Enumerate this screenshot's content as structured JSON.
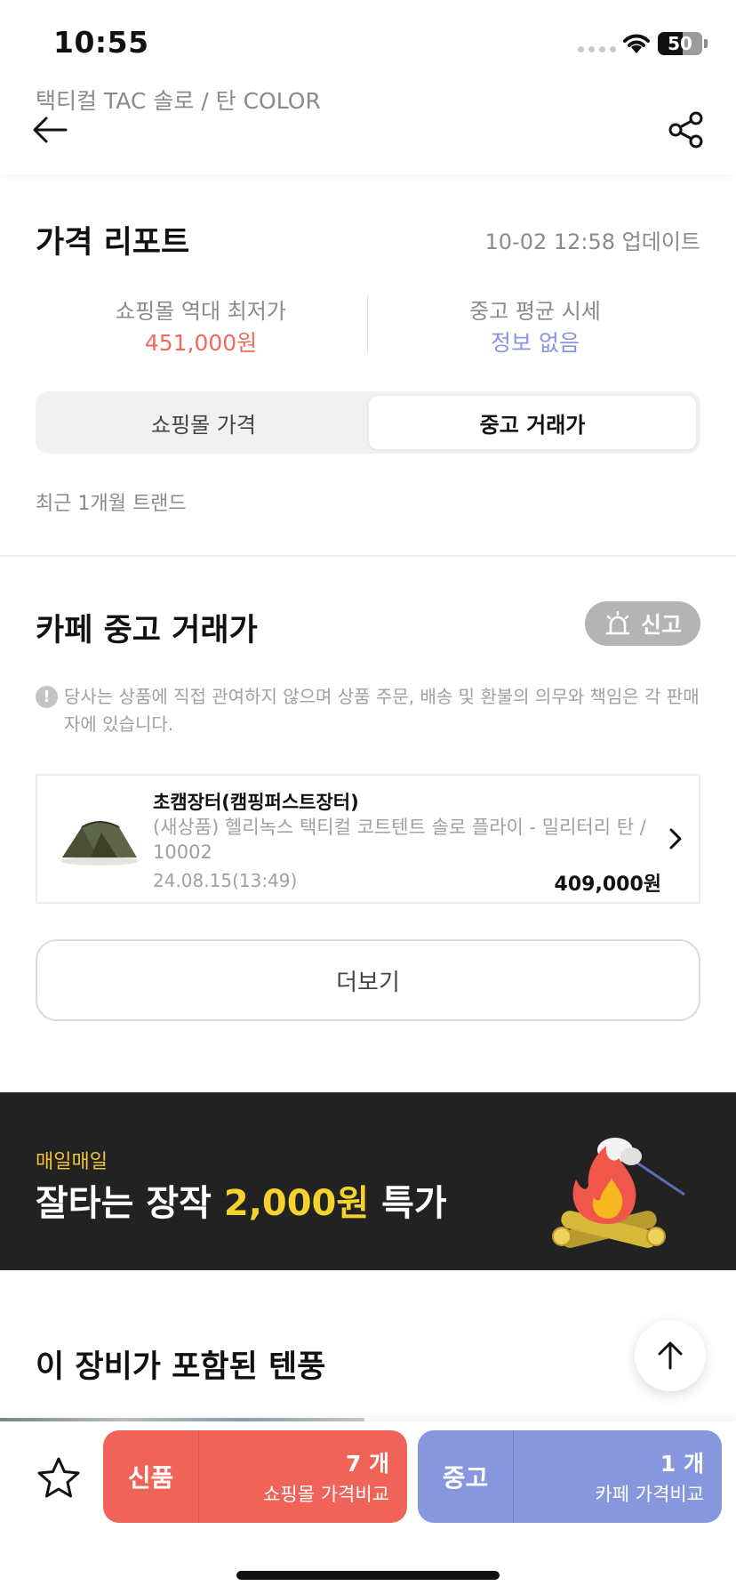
{
  "status_bar": {
    "time": "10:55",
    "battery": "50"
  },
  "header": {
    "subtitle": "택티컬 TAC 솔로 / 탄 COLOR"
  },
  "price_report": {
    "title": "가격 리포트",
    "updated": "10-02 12:58 업데이트",
    "lowest_label": "쇼핑몰 역대 최저가",
    "lowest_value": "451,000원",
    "used_avg_label": "중고 평균 시세",
    "used_avg_value": "정보 없음",
    "tabs": [
      {
        "label": "쇼핑몰 가격",
        "active": false
      },
      {
        "label": "중고 거래가",
        "active": true
      }
    ],
    "trend_label": "최근 1개월 트랜드"
  },
  "cafe": {
    "title": "카페 중고 거래가",
    "report_label": "신고",
    "notice": "당사는 상품에 직접 관여하지 않으며 상품 주문, 배송 및 환불의 의무와 책임은 각 판매자에 있습니다.",
    "listings": [
      {
        "seller": "초캠장터(캠핑퍼스트장터)",
        "title": "(새상품) 헬리녹스 택티컬 코트텐트 솔로 플라이 - 밀리터리 탄 / 10002",
        "date": "24.08.15(13:49)",
        "price": "409,000원"
      }
    ],
    "more_label": "더보기"
  },
  "banner": {
    "tag": "매일매일",
    "headline_pre": "잘타는 장작 ",
    "headline_highlight": "2,000원",
    "headline_post": " 특가"
  },
  "bundle": {
    "title": "이 장비가 포함된 텐풍"
  },
  "bottom_bar": {
    "new": {
      "label": "신품",
      "count": "7 개",
      "sub": "쇼핑몰 가격비교"
    },
    "used": {
      "label": "중고",
      "count": "1 개",
      "sub": "카페 가격비교"
    }
  },
  "colors": {
    "lowest_price": "#ef6b5e",
    "used_avg": "#8a94e0",
    "cta_new": "#ef6358",
    "cta_used": "#8797de",
    "banner_bg": "#222222",
    "banner_highlight": "#f7d22d"
  },
  "icons": [
    "back-arrow-icon",
    "share-icon",
    "alarm-icon",
    "info-icon",
    "chevron-right-icon",
    "campfire-icon",
    "arrow-up-icon",
    "star-icon",
    "wifi-icon"
  ]
}
